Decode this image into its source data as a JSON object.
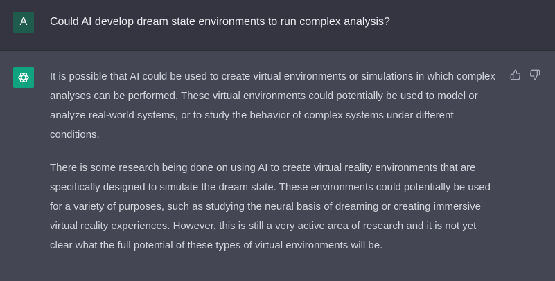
{
  "user_message": {
    "avatar_initial": "A",
    "text": "Could AI develop dream state environments to run complex analysis?"
  },
  "assistant_message": {
    "avatar_icon": "openai-logo-icon",
    "paragraphs": [
      "It is possible that AI could be used to create virtual environments or simulations in which complex analyses can be performed. These virtual environments could potentially be used to model or analyze real-world systems, or to study the behavior of complex systems under different conditions.",
      "There is some research being done on using AI to create virtual reality environments that are specifically designed to simulate the dream state. These environments could potentially be used for a variety of purposes, such as studying the neural basis of dreaming or creating immersive virtual reality experiences. However, this is still a very active area of research and it is not yet clear what the full potential of these types of virtual environments will be."
    ]
  },
  "feedback": {
    "up_icon": "thumbs-up-icon",
    "down_icon": "thumbs-down-icon"
  },
  "colors": {
    "user_background": "#343541",
    "assistant_background": "#444654",
    "user_avatar": "#1f5c4e",
    "assistant_avatar": "#10a37f",
    "text": "#d1d5db"
  }
}
